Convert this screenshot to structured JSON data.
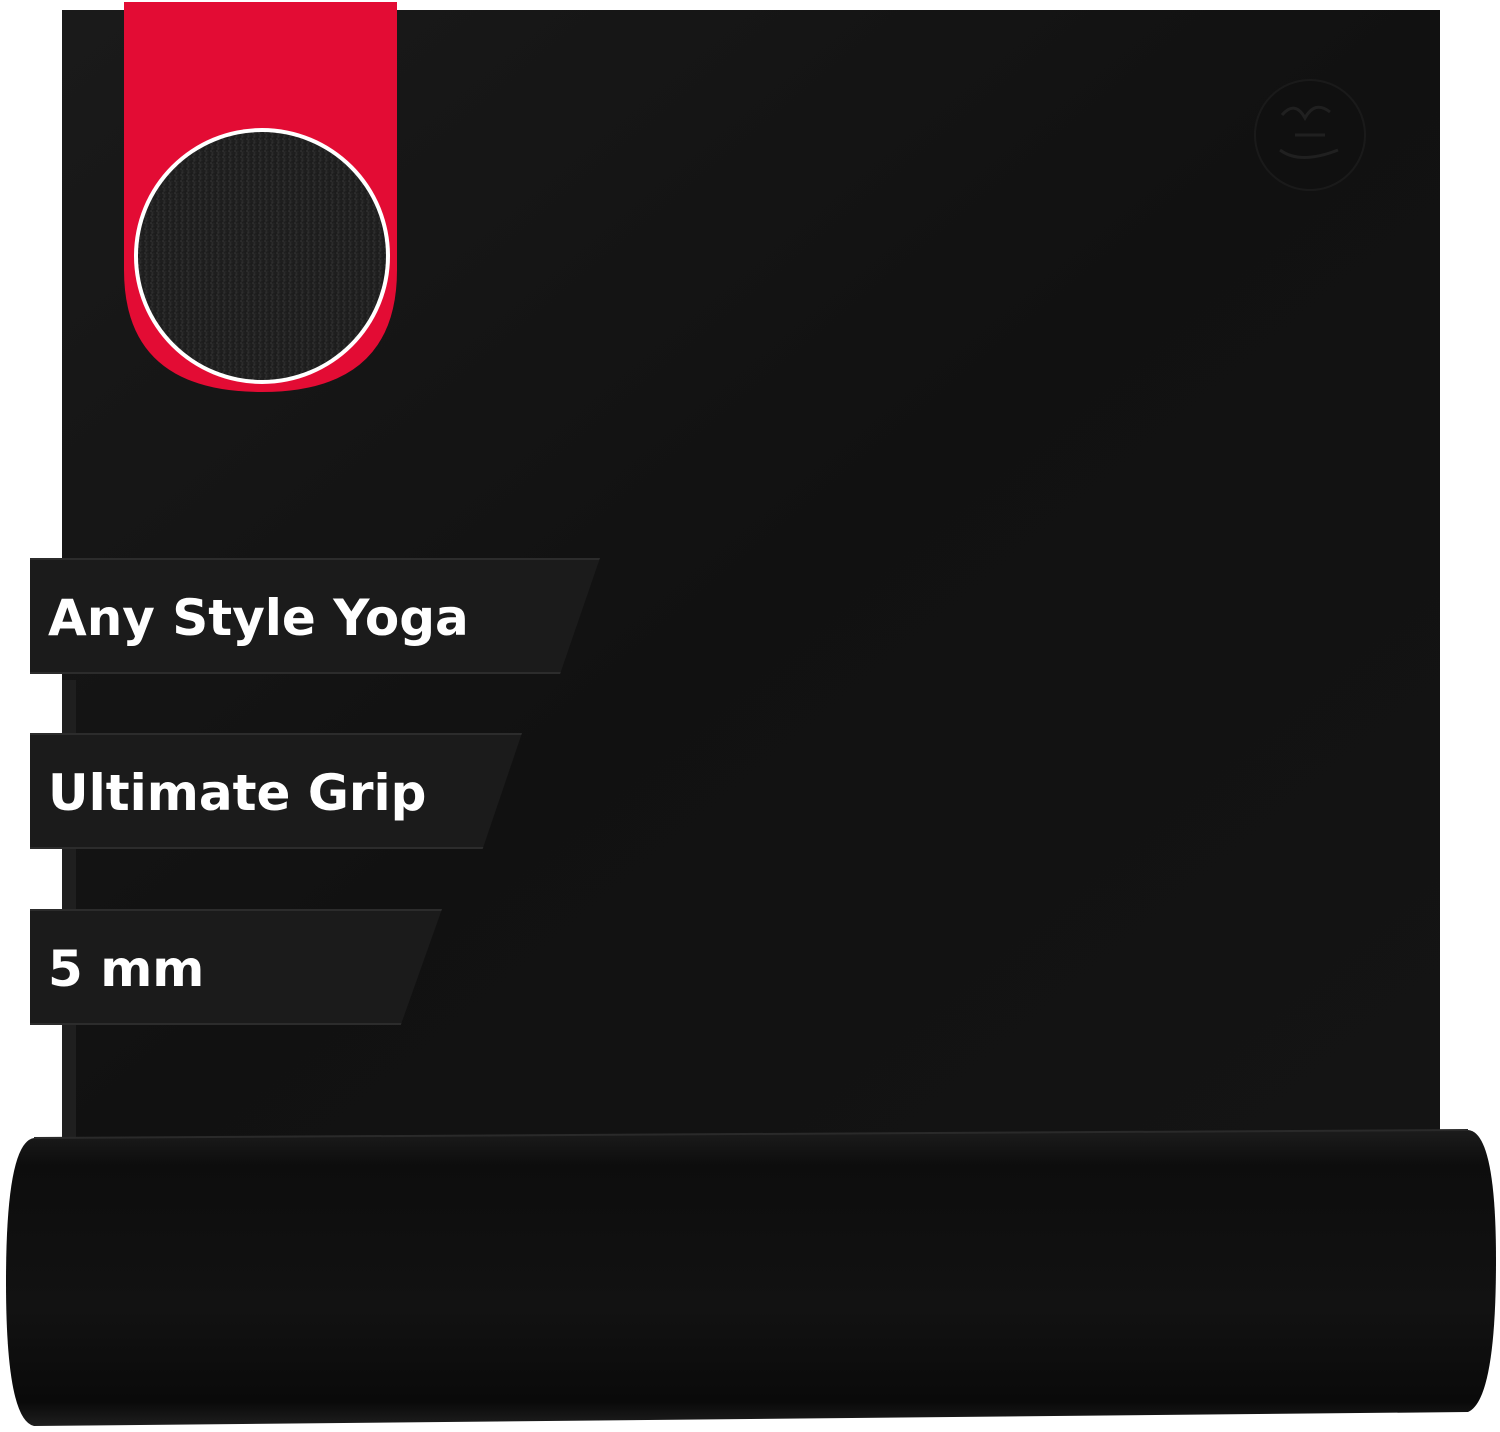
{
  "features": [
    {
      "label": "Any Style Yoga"
    },
    {
      "label": "Ultimate Grip"
    },
    {
      "label": "5 mm"
    }
  ],
  "colors": {
    "mat": "#121212",
    "roll": "#0e0e0e",
    "accent_tag": "#e30c34",
    "label_background": "#1b1b1b",
    "label_text": "#ffffff"
  },
  "icons": {
    "brand_logo": "manduka-logo-icon",
    "texture_swatch": "texture-swatch-icon"
  }
}
